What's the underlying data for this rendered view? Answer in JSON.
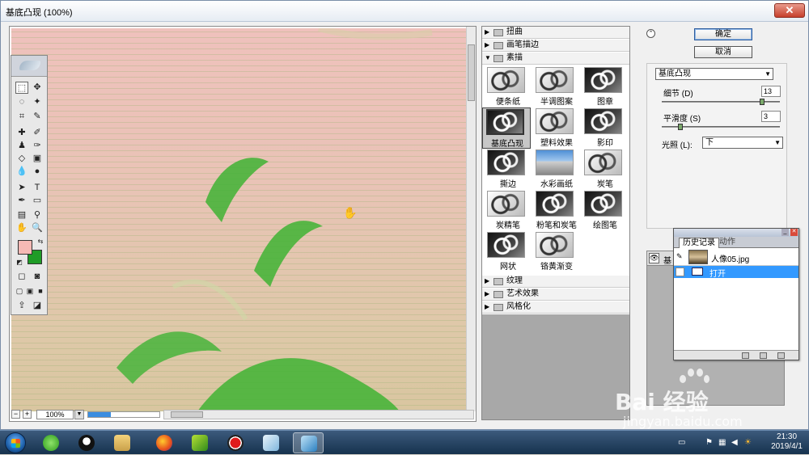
{
  "window": {
    "title": "基底凸现 (100%)",
    "close_glyph": "✕"
  },
  "preview": {
    "zoom_out_glyph": "−",
    "zoom_in_glyph": "+",
    "zoom_value": "100%",
    "progress": 0.32
  },
  "categories": [
    {
      "label": "扭曲",
      "expanded": false
    },
    {
      "label": "画笔描边",
      "expanded": false
    },
    {
      "label": "素描",
      "expanded": true
    },
    {
      "label": "纹理",
      "expanded": false
    },
    {
      "label": "艺术效果",
      "expanded": false
    },
    {
      "label": "风格化",
      "expanded": false
    }
  ],
  "sketch_filters": [
    {
      "label": "便条纸"
    },
    {
      "label": "半调图案"
    },
    {
      "label": "图章"
    },
    {
      "label": "基底凸现",
      "selected": true
    },
    {
      "label": "塑料效果"
    },
    {
      "label": "影印"
    },
    {
      "label": "撕边"
    },
    {
      "label": "水彩画纸"
    },
    {
      "label": "炭笔"
    },
    {
      "label": "炭精笔"
    },
    {
      "label": "粉笔和炭笔"
    },
    {
      "label": "绘图笔"
    },
    {
      "label": "网状"
    },
    {
      "label": "铬黄渐变"
    }
  ],
  "buttons": {
    "ok": "确定",
    "cancel": "取消"
  },
  "settings": {
    "filter_select": "基底凸现",
    "detail_label": "细节 (D)",
    "detail_value": "13",
    "smooth_label": "平滑度 (S)",
    "smooth_value": "3",
    "light_label": "光照 (L):",
    "light_value": "下"
  },
  "layers": {
    "row_label": "基"
  },
  "history": {
    "tab_history": "历史记录",
    "tab_actions": "动作",
    "source_label": "人像05.jpg",
    "step_label": "打开"
  },
  "taskbar": {
    "time": "21:30",
    "date": "2019/4/1"
  },
  "watermark": {
    "brand": "Bai  经验",
    "url": "jingyan.baidu.com"
  },
  "colors": {
    "foreground": "#f6b9b5",
    "background": "#1f9c27",
    "highlight": "#3399ff"
  }
}
